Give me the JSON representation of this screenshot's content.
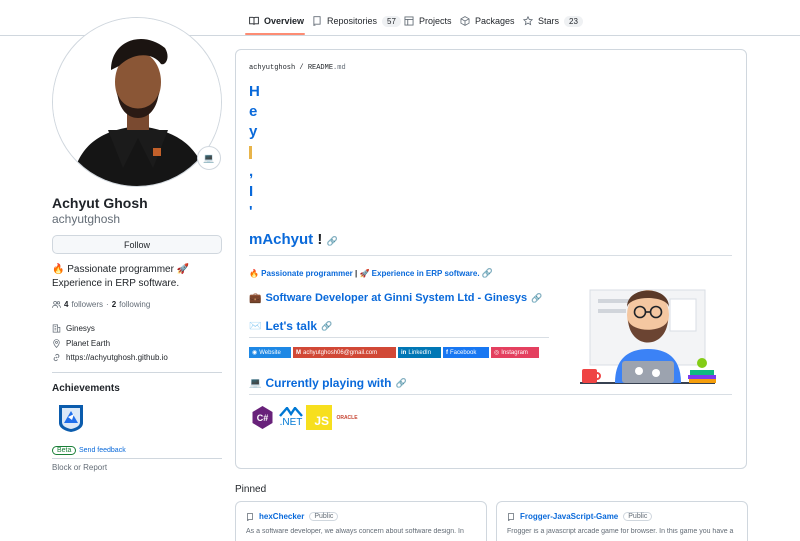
{
  "tabs": [
    {
      "label": "Overview",
      "count": null,
      "icon": "book-icon"
    },
    {
      "label": "Repositories",
      "count": "57",
      "icon": "repo-icon"
    },
    {
      "label": "Projects",
      "count": null,
      "icon": "table-icon"
    },
    {
      "label": "Packages",
      "count": null,
      "icon": "package-icon"
    },
    {
      "label": "Stars",
      "count": "23",
      "icon": "star-icon"
    }
  ],
  "profile": {
    "status_emoji": "💻",
    "full_name": "Achyut Ghosh",
    "username": "achyutghosh",
    "follow_label": "Follow",
    "bio_line1": "🔥 Passionate programmer 🚀",
    "bio_line2": "Experience in ERP software.",
    "followers_count": "4",
    "followers_label": "followers",
    "dot": "·",
    "following_count": "2",
    "following_label": "following",
    "company": "Ginesys",
    "location": "Planet Earth",
    "website": "https://achyutghosh.github.io"
  },
  "achievements": {
    "title": "Achievements",
    "beta_label": "Beta",
    "feedback_label": "Send feedback",
    "block_label": "Block or Report"
  },
  "readme": {
    "crumb_user": "achyutghosh",
    "crumb_sep": "/",
    "crumb_file": "README",
    "crumb_ext": ".md",
    "hey_letters": [
      "H",
      "e",
      "y",
      "",
      ",",
      "I",
      "'"
    ],
    "name_prefix": "m",
    "name": "Achyut",
    "bang": "!",
    "link1": "🔥 Passionate programmer",
    "link_sep": "|",
    "link2": "🚀 Experience in ERP software.",
    "job": "Software Developer at Ginni System Ltd - Ginesys",
    "talk": "Let's talk",
    "playing": "Currently playing with",
    "socials": [
      {
        "label": "Website",
        "color": "#1e88e5"
      },
      {
        "label": "achyutghosh06@gmail.com",
        "color": "#d14836"
      },
      {
        "label": "LinkedIn",
        "color": "#0077b5"
      },
      {
        "label": "Facebook",
        "color": "#1877f2"
      },
      {
        "label": "Instagram",
        "color": "#e4405f"
      }
    ],
    "tech": [
      "C#",
      ".NET",
      "JS",
      "ORACLE"
    ]
  },
  "pinned": {
    "title": "Pinned",
    "repos": [
      {
        "name": "hexChecker",
        "visibility": "Public",
        "desc": "As a software developer, we always concern about software design. In"
      },
      {
        "name": "Frogger-JavaScript-Game",
        "visibility": "Public",
        "desc": "Frogger is a javascript arcade game for browser. In this game you have a"
      }
    ]
  }
}
